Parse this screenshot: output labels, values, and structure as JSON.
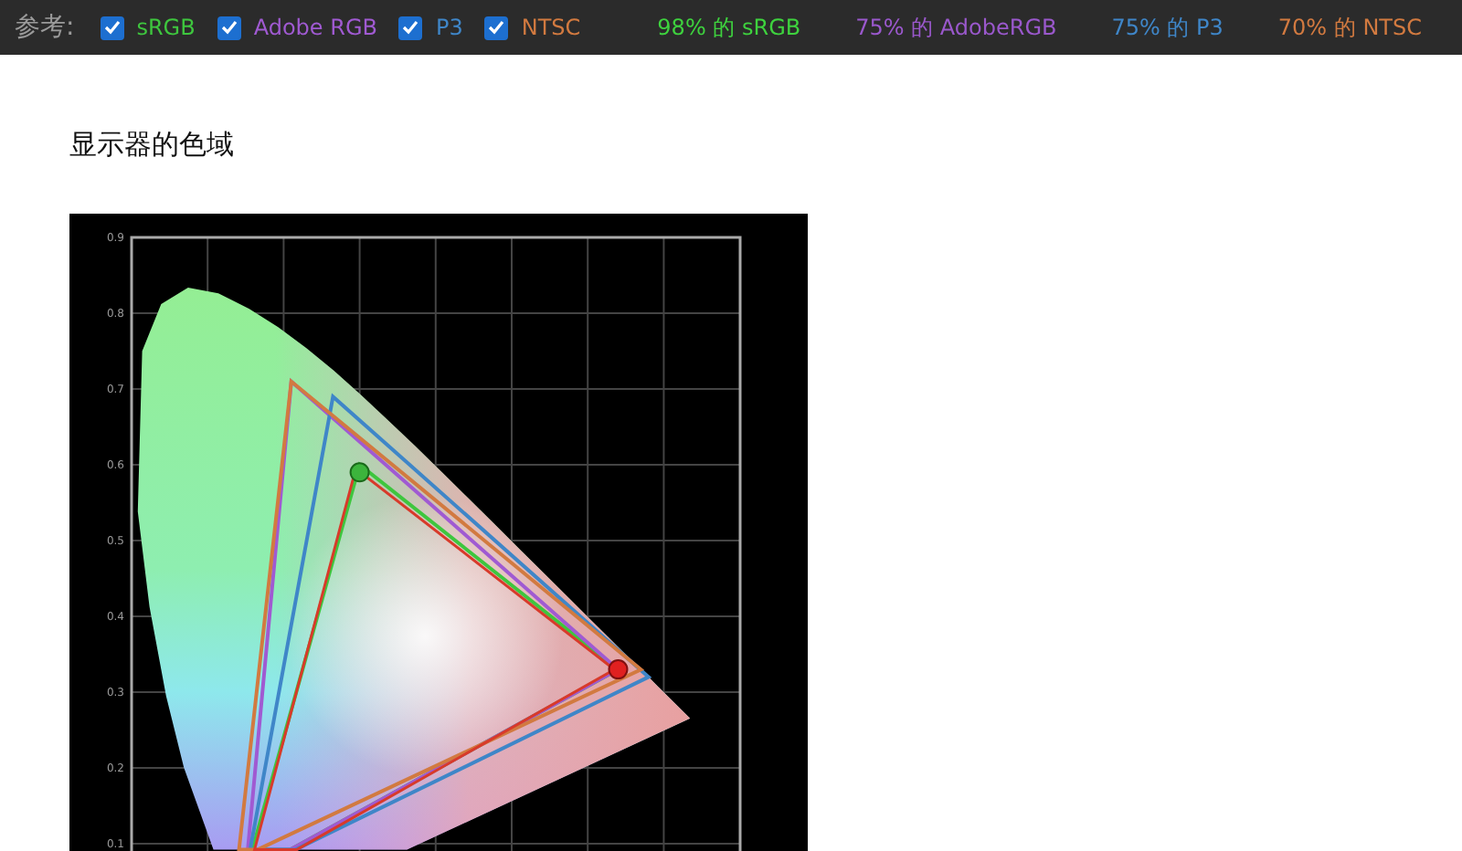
{
  "toolbar": {
    "label": "参考:",
    "references": [
      {
        "kind": "srgb",
        "label": "sRGB",
        "checked": true,
        "color": "#3ec63e"
      },
      {
        "kind": "adobe",
        "label": "Adobe RGB",
        "checked": true,
        "color": "#a05ad2"
      },
      {
        "kind": "p3",
        "label": "P3",
        "checked": true,
        "color": "#3f86c8"
      },
      {
        "kind": "ntsc",
        "label": "NTSC",
        "checked": true,
        "color": "#d27a40"
      }
    ],
    "coverage": [
      {
        "text": "98% 的 sRGB",
        "color": "#3ed23e"
      },
      {
        "text": "75% 的 AdobeRGB",
        "color": "#9a58cc"
      },
      {
        "text": "75% 的 P3",
        "color": "#3f86c8"
      },
      {
        "text": "70% 的 NTSC",
        "color": "#d27a40"
      }
    ]
  },
  "section": {
    "title": "显示器的色域",
    "chart": {
      "yticks": [
        "0.9",
        "0.8",
        "0.7",
        "0.6",
        "0.5",
        "0.4",
        "0.3",
        "0.2",
        "0.1"
      ]
    }
  }
}
